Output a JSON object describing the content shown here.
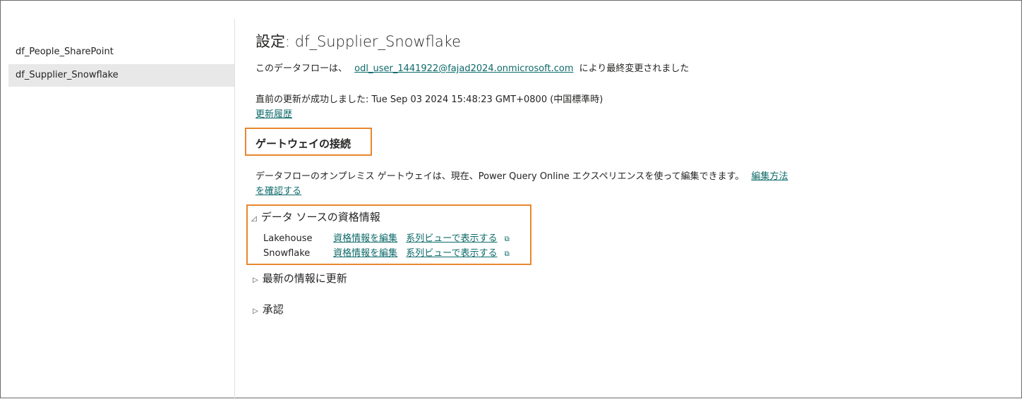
{
  "sidebar": {
    "items": [
      {
        "label": "df_People_SharePoint",
        "selected": false
      },
      {
        "label": "df_Supplier_Snowflake",
        "selected": true
      }
    ]
  },
  "main": {
    "title": "設定: df_Supplier_Snowflake",
    "modified": {
      "prefix": "このデータフローは、",
      "user_link": "odl_user_1441922@fajad2024.onmicrosoft.com",
      "suffix": "により最終変更されました"
    },
    "last_refresh": "直前の更新が成功しました: Tue Sep 03 2024 15:48:23 GMT+0800 (中国標準時)",
    "refresh_history_link": "更新履歴",
    "gateway": {
      "heading": "ゲートウェイの接続",
      "description": "データフローのオンプレミス ゲートウェイは、現在、Power Query Online エクスペリエンスを使って編集できます。",
      "link_part1": "編集方法",
      "link_part2": "を確認する"
    },
    "credentials": {
      "heading": "データ ソースの資格情報",
      "expanded": true,
      "rows": [
        {
          "source": "Lakehouse",
          "edit_link": "資格情報を編集",
          "lineage_link": "系列ビューで表示する"
        },
        {
          "source": "Snowflake",
          "edit_link": "資格情報を編集",
          "lineage_link": "系列ビューで表示する"
        }
      ]
    },
    "refresh_section": {
      "heading": "最新の情報に更新",
      "expanded": false
    },
    "approval_section": {
      "heading": "承認",
      "expanded": false
    }
  },
  "colors": {
    "accent_link": "#0e6a6a",
    "highlight_box": "#e8872f",
    "selected_bg": "#e8e8e8"
  }
}
